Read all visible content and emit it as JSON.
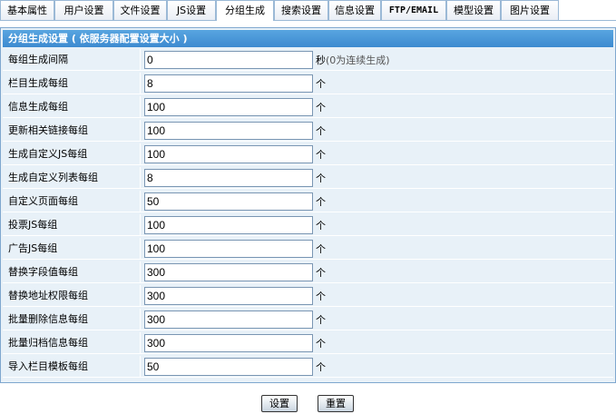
{
  "tabs": [
    {
      "label": "基本属性"
    },
    {
      "label": "用户设置"
    },
    {
      "label": "文件设置"
    },
    {
      "label": "JS设置"
    },
    {
      "label": "分组生成"
    },
    {
      "label": "搜索设置"
    },
    {
      "label": "信息设置"
    },
    {
      "label": "FTP/EMAIL"
    },
    {
      "label": "模型设置"
    },
    {
      "label": "图片设置"
    }
  ],
  "active_tab": "分组生成",
  "panel": {
    "title": "分组生成设置 ( 依服务器配置设置大小 )",
    "rows": [
      {
        "label": "每组生成间隔",
        "value": "0",
        "unit": "秒",
        "note": "(0为连续生成)"
      },
      {
        "label": "栏目生成每组",
        "value": "8",
        "unit": "个"
      },
      {
        "label": "信息生成每组",
        "value": "100",
        "unit": "个"
      },
      {
        "label": "更新相关链接每组",
        "value": "100",
        "unit": "个"
      },
      {
        "label": "生成自定义JS每组",
        "value": "100",
        "unit": "个"
      },
      {
        "label": "生成自定义列表每组",
        "value": "8",
        "unit": "个"
      },
      {
        "label": "自定义页面每组",
        "value": "50",
        "unit": "个"
      },
      {
        "label": "投票JS每组",
        "value": "100",
        "unit": "个"
      },
      {
        "label": "广告JS每组",
        "value": "100",
        "unit": "个"
      },
      {
        "label": "替换字段值每组",
        "value": "300",
        "unit": "个"
      },
      {
        "label": "替换地址权限每组",
        "value": "300",
        "unit": "个"
      },
      {
        "label": "批量删除信息每组",
        "value": "300",
        "unit": "个"
      },
      {
        "label": "批量归档信息每组",
        "value": "300",
        "unit": "个"
      },
      {
        "label": "导入栏目模板每组",
        "value": "50",
        "unit": "个"
      }
    ]
  },
  "buttons": {
    "submit": "设置",
    "reset": "重置"
  },
  "colors": {
    "header": "#4a97d8",
    "panel_bg": "#e8f1f8",
    "border": "#7fa7cf"
  }
}
